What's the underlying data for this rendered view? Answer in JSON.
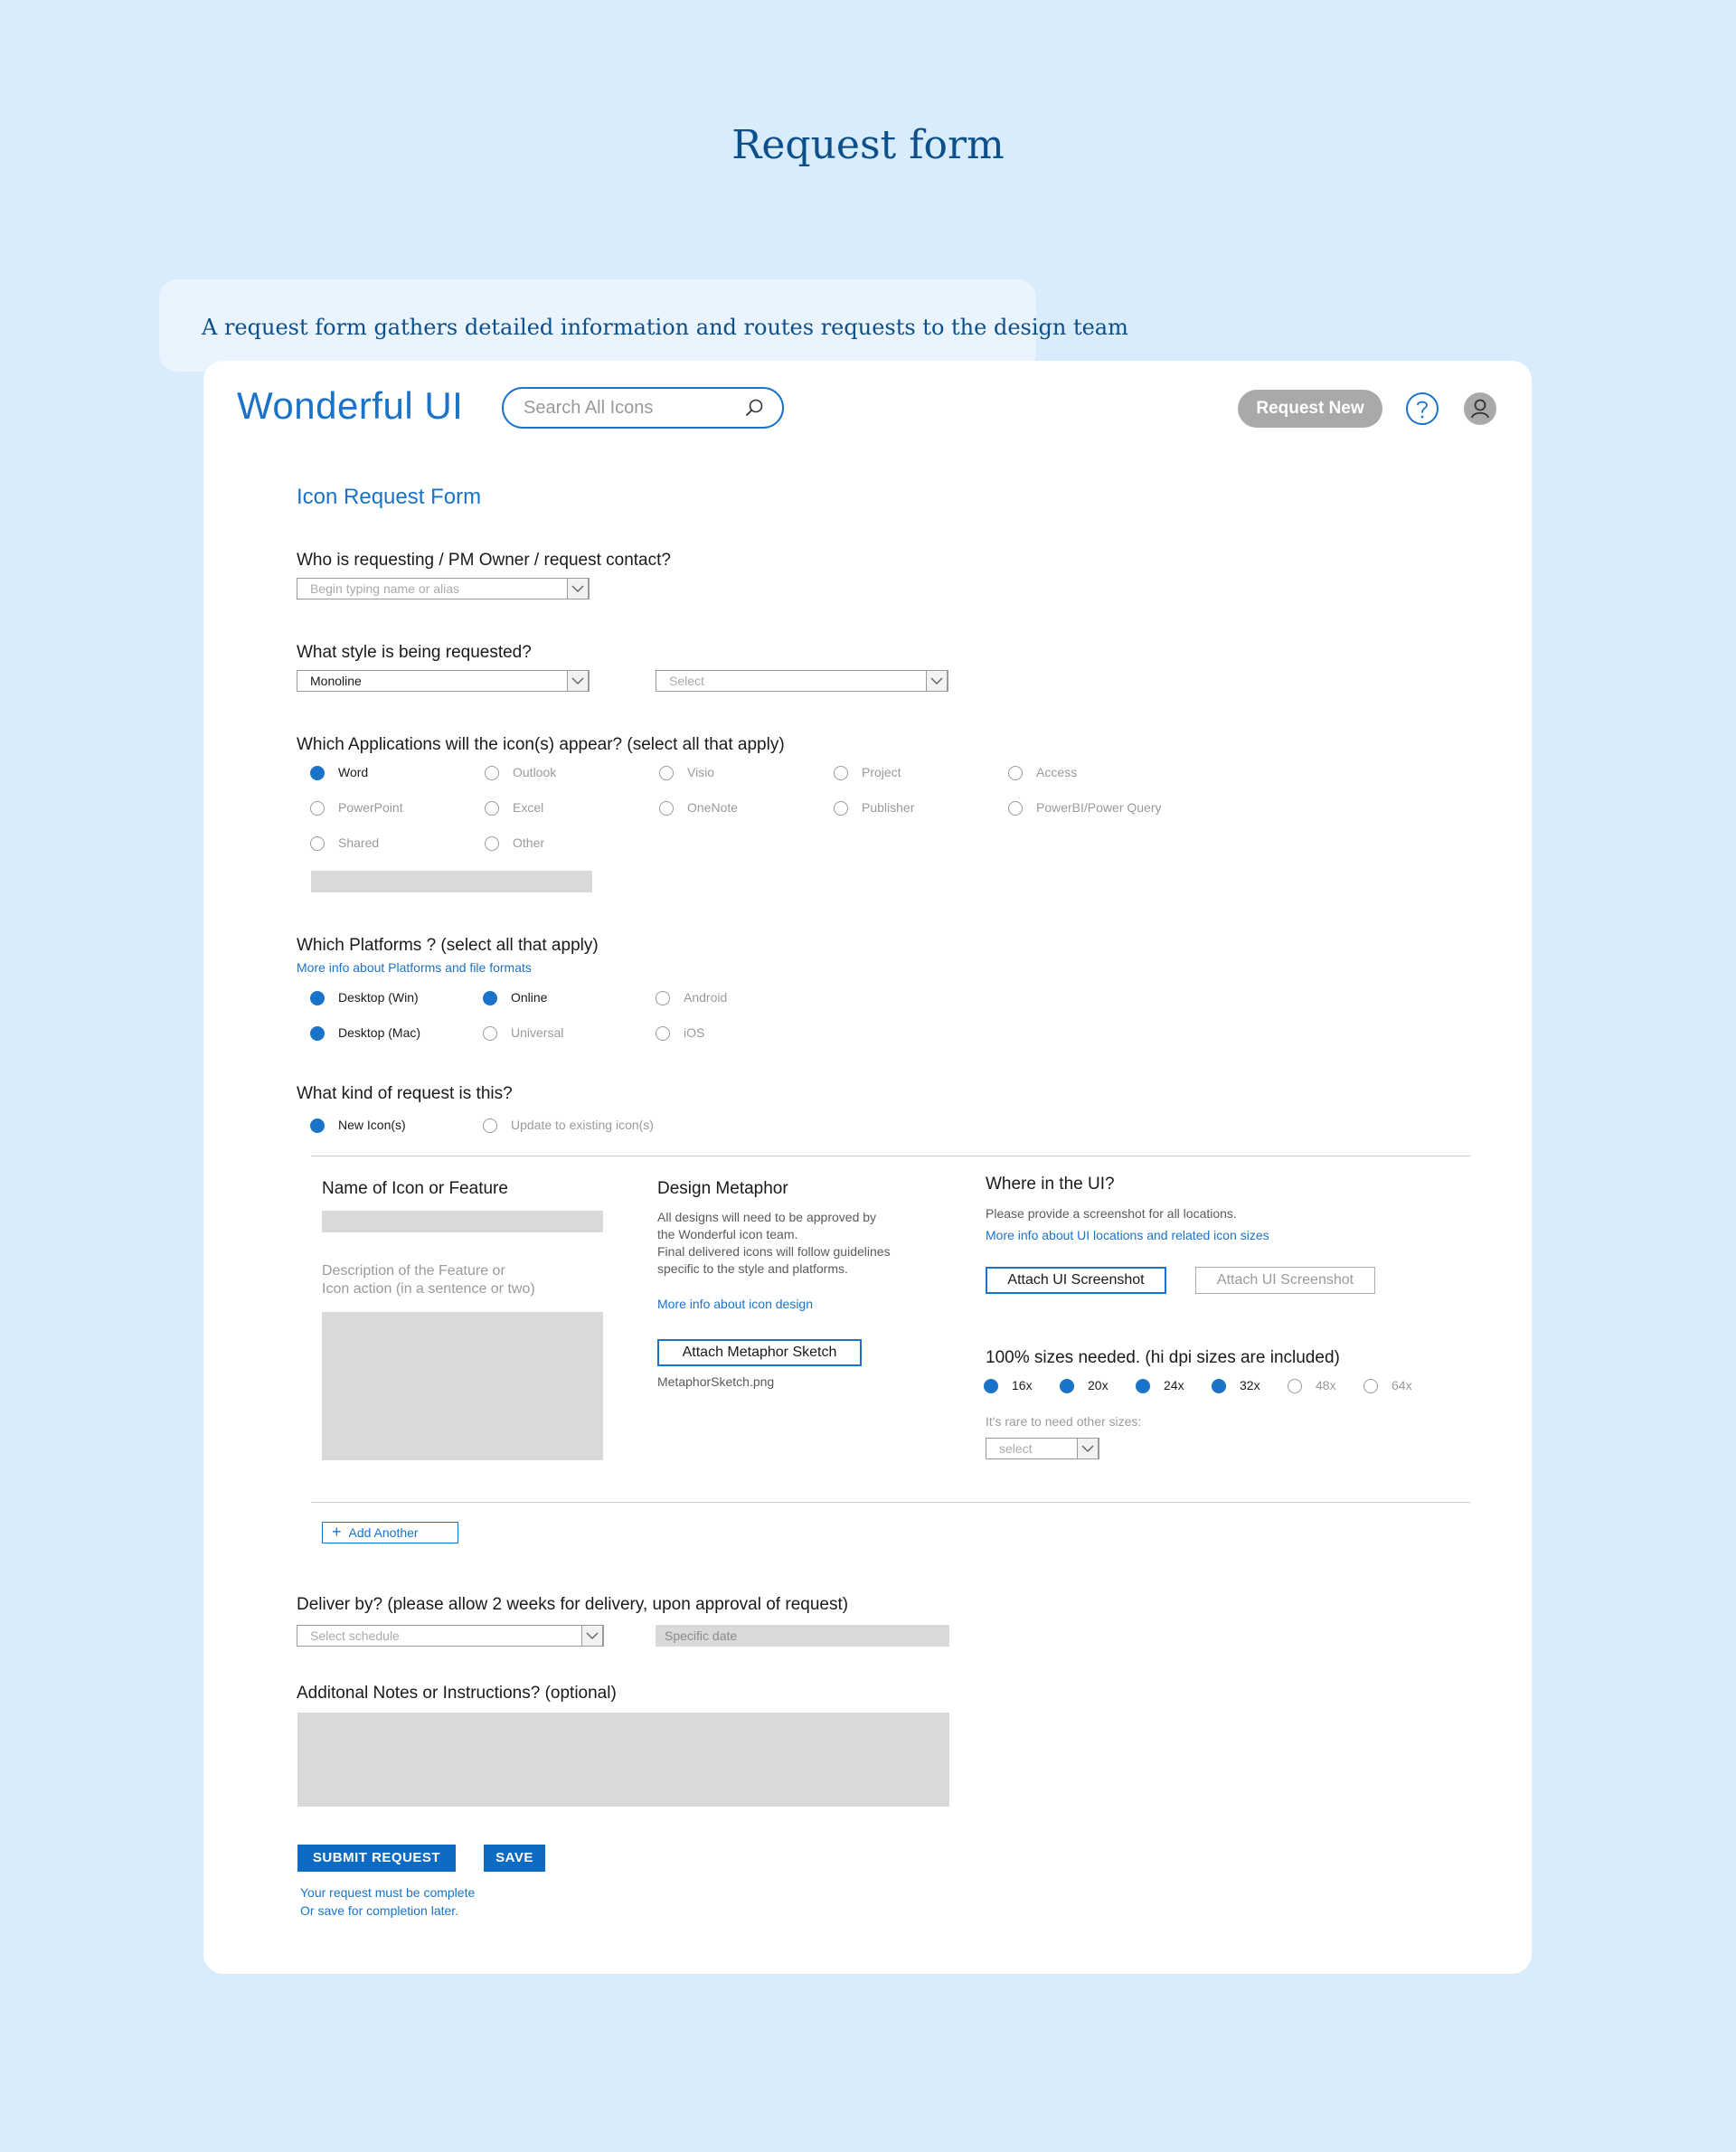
{
  "page_title": "Request form",
  "callout": "A request form gathers detailed information and routes requests to the design team",
  "header": {
    "logo": "Wonderful UI",
    "search_placeholder": "Search All Icons",
    "request_new": "Request New"
  },
  "form": {
    "title": "Icon Request Form",
    "requester": {
      "question": "Who is requesting / PM Owner / request contact?",
      "placeholder": "Begin typing name or alias"
    },
    "style": {
      "question": "What style is being requested?",
      "value": "Monoline",
      "second_placeholder": "Select"
    },
    "applications": {
      "question": "Which Applications will the icon(s) appear? (select all that apply)",
      "options": [
        {
          "label": "Word",
          "checked": true
        },
        {
          "label": "Outlook",
          "checked": false
        },
        {
          "label": "Visio",
          "checked": false
        },
        {
          "label": "Project",
          "checked": false
        },
        {
          "label": "Access",
          "checked": false
        },
        {
          "label": "PowerPoint",
          "checked": false
        },
        {
          "label": "Excel",
          "checked": false
        },
        {
          "label": "OneNote",
          "checked": false
        },
        {
          "label": "Publisher",
          "checked": false
        },
        {
          "label": "PowerBI/Power Query",
          "checked": false
        },
        {
          "label": "Shared",
          "checked": false
        },
        {
          "label": "Other",
          "checked": false
        }
      ]
    },
    "platforms": {
      "question": "Which Platforms ? (select all that apply)",
      "link": "More info about Platforms and file formats",
      "options": [
        {
          "label": "Desktop (Win)",
          "checked": true
        },
        {
          "label": "Online",
          "checked": true
        },
        {
          "label": "Android",
          "checked": false
        },
        {
          "label": "Desktop (Mac)",
          "checked": true
        },
        {
          "label": "Universal",
          "checked": false
        },
        {
          "label": "iOS",
          "checked": false
        }
      ]
    },
    "kind": {
      "question": "What kind of request is this?",
      "options": [
        {
          "label": "New Icon(s)",
          "checked": true
        },
        {
          "label": "Update to existing icon(s)",
          "checked": false
        }
      ]
    },
    "icon_block": {
      "name_label": "Name of Icon or Feature",
      "description_label": "Description of the Feature or\nIcon action (in a sentence or two)",
      "metaphor": {
        "title": "Design Metaphor",
        "text": "All designs will need to be approved by\nthe Wonderful icon team.\nFinal delivered icons will follow guidelines\nspecific to the style and platforms.",
        "link": "More info about icon design",
        "attach_button": "Attach Metaphor Sketch",
        "file_name": "MetaphorSketch.png"
      },
      "where": {
        "title": "Where in the UI?",
        "text": "Please provide a screenshot for all locations.",
        "link": "More info about UI locations and related icon sizes",
        "attach_button": "Attach UI Screenshot",
        "attach_button_disabled": "Attach UI Screenshot"
      },
      "sizes": {
        "title": "100% sizes needed. (hi dpi  sizes are included)",
        "options": [
          {
            "label": "16x",
            "checked": true
          },
          {
            "label": "20x",
            "checked": true
          },
          {
            "label": "24x",
            "checked": true
          },
          {
            "label": "32x",
            "checked": true
          },
          {
            "label": "48x",
            "checked": false
          },
          {
            "label": "64x",
            "checked": false
          }
        ],
        "other_label": "It's rare to need other sizes:",
        "other_placeholder": "select"
      }
    },
    "add_another": "Add Another",
    "deliver": {
      "question": "Deliver by? (please allow 2 weeks for delivery, upon approval of request)",
      "schedule_placeholder": "Select schedule",
      "date_placeholder": "Specific date"
    },
    "notes": {
      "question": "Additonal Notes or Instructions? (optional)"
    },
    "submit": "SUBMIT REQUEST",
    "save": "SAVE",
    "footer_note": "Your request must be complete\nOr save for completion later."
  },
  "colors": {
    "background": "#d9ecfc",
    "accent": "#1a73c8",
    "heading": "#0c4f8a",
    "button_grey": "#a9a9a9"
  }
}
